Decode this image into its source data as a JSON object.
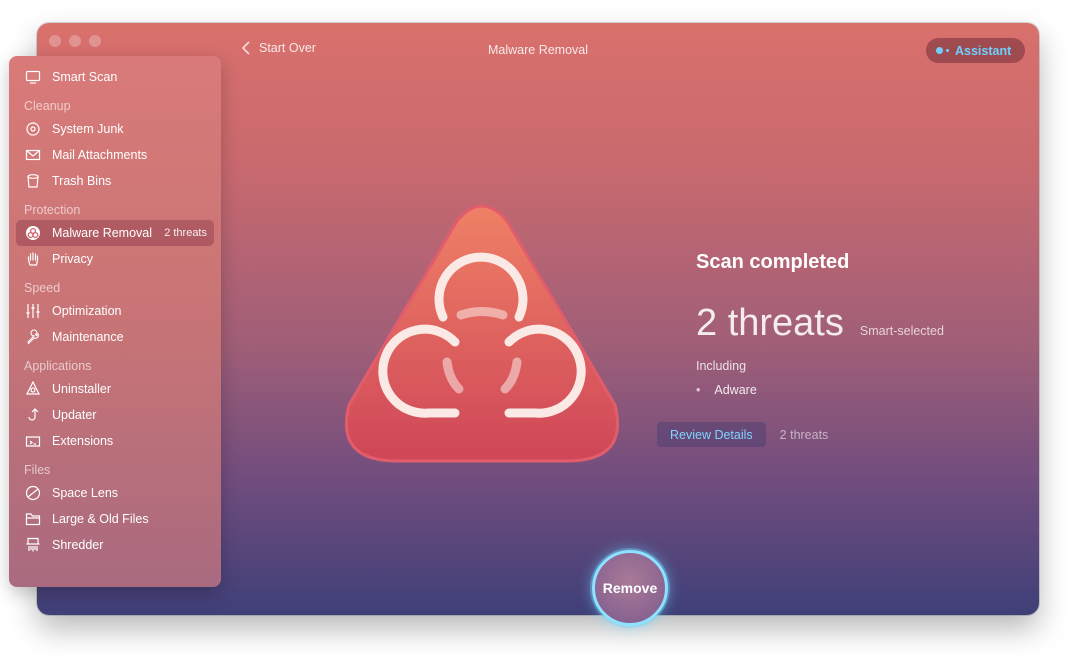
{
  "window": {
    "title": "Malware Removal"
  },
  "toolbar": {
    "back_label": "Start Over",
    "assistant_label": "Assistant"
  },
  "sidebar": {
    "smart_scan": "Smart Scan",
    "sections": [
      {
        "title": "Cleanup",
        "items": [
          "System Junk",
          "Mail Attachments",
          "Trash Bins"
        ]
      },
      {
        "title": "Protection",
        "items": [
          "Malware Removal",
          "Privacy"
        ]
      },
      {
        "title": "Speed",
        "items": [
          "Optimization",
          "Maintenance"
        ]
      },
      {
        "title": "Applications",
        "items": [
          "Uninstaller",
          "Updater",
          "Extensions"
        ]
      },
      {
        "title": "Files",
        "items": [
          "Space Lens",
          "Large & Old Files",
          "Shredder"
        ]
      }
    ],
    "active_badge": "2 threats"
  },
  "results": {
    "title": "Scan completed",
    "threats_count": "2 threats",
    "smart_selected": "Smart-selected",
    "including": "Including",
    "items": [
      "Adware"
    ],
    "review_button": "Review Details",
    "review_count": "2 threats"
  },
  "action": {
    "remove_label": "Remove"
  },
  "colors": {
    "accent": "#6fd0ff",
    "remove_ring": "#8ee2ff"
  }
}
